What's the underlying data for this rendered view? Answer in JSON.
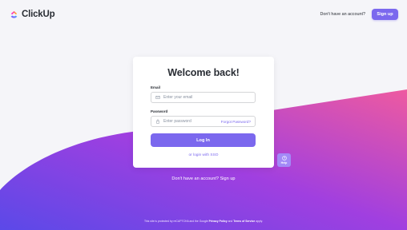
{
  "header": {
    "logo_text": "ClickUp",
    "no_account_text": "Don't have an account?",
    "signup_label": "Sign up"
  },
  "card": {
    "title": "Welcome back!",
    "email_label": "Email",
    "email_placeholder": "Enter your email",
    "password_label": "Password",
    "password_placeholder": "Enter password",
    "forgot_label": "Forgot Password?",
    "login_label": "Log In",
    "sso_label": "or login with SSO"
  },
  "help": {
    "label": "Help"
  },
  "bottom": {
    "signup_text": "Don't have an account? Sign up"
  },
  "footer": {
    "prefix": "This site is protected by reCAPTCHA and the Google",
    "privacy": "Privacy Policy",
    "and": "and",
    "terms": "Terms of Service",
    "suffix": "apply."
  },
  "colors": {
    "accent": "#7b68ee",
    "gradient_start": "#5b49e8",
    "gradient_mid": "#a03fe0",
    "gradient_end": "#ee5aa0"
  },
  "icons": [
    "clickup-logo-icon",
    "mail-icon",
    "lock-icon",
    "help-icon"
  ]
}
